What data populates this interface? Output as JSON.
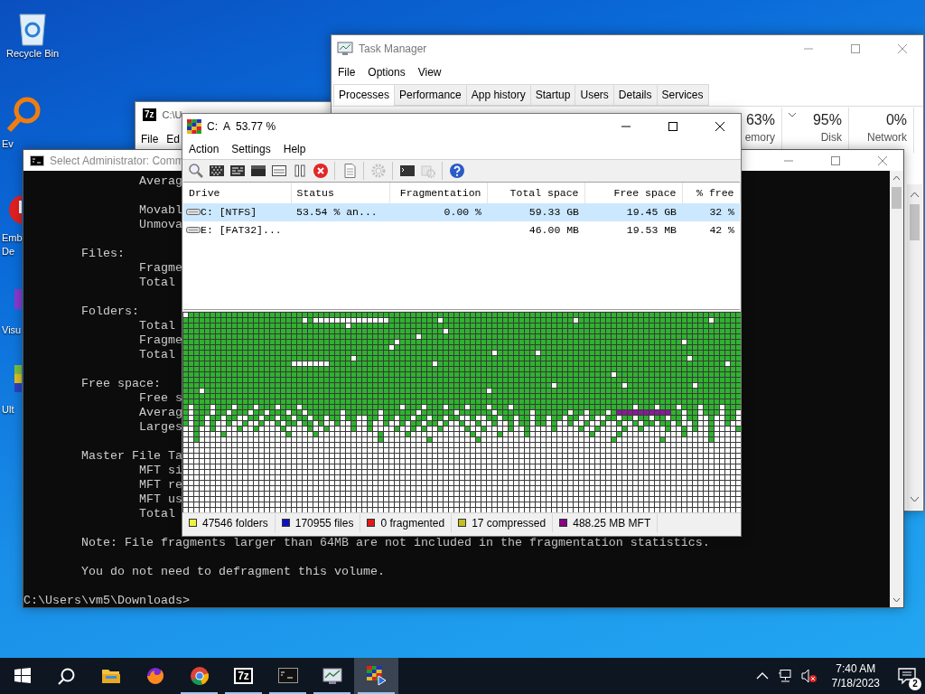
{
  "desktop_icons": [
    {
      "kind": "recycle",
      "lines": [
        "Recycle Bin"
      ]
    },
    {
      "kind": "magnifier",
      "lines": [
        "Ev"
      ]
    },
    {
      "kind": "redball",
      "lines": [
        "Emb",
        "De"
      ]
    },
    {
      "kind": "purple",
      "lines": [
        "Visu"
      ]
    },
    {
      "kind": "bars",
      "lines": [
        "Ult"
      ]
    }
  ],
  "seven_zip_window": {
    "logo": "7z",
    "title": "C:\\U",
    "menu": [
      "File",
      "Ed"
    ]
  },
  "task_manager": {
    "title": "Task Manager",
    "menu": [
      "File",
      "Options",
      "View"
    ],
    "tabs": [
      {
        "label": "Processes",
        "selected": true
      },
      {
        "label": "Performance",
        "selected": false
      },
      {
        "label": "App history",
        "selected": false
      },
      {
        "label": "Startup",
        "selected": false
      },
      {
        "label": "Users",
        "selected": false
      },
      {
        "label": "Details",
        "selected": false
      },
      {
        "label": "Services",
        "selected": false
      }
    ],
    "columns": [
      {
        "value": "63%",
        "label": "emory",
        "sorted": false
      },
      {
        "value": "95%",
        "label": "Disk",
        "sorted": true
      },
      {
        "value": "0%",
        "label": "Network",
        "sorted": false
      }
    ]
  },
  "cmd_window": {
    "title": "Select Administrator: Comm",
    "blocks": [
      [
        {
          "kind": "detail",
          "text": "Averag"
        }
      ],
      [
        {
          "kind": "detail",
          "text": "Movabl"
        },
        {
          "kind": "detail",
          "text": "Unmova"
        }
      ],
      [
        {
          "kind": "section",
          "text": "Files:"
        },
        {
          "kind": "detail",
          "text": "Fragme"
        },
        {
          "kind": "detail",
          "text": "Total"
        }
      ],
      [
        {
          "kind": "section",
          "text": "Folders:"
        },
        {
          "kind": "detail",
          "text": "Total"
        },
        {
          "kind": "detail",
          "text": "Fragme"
        },
        {
          "kind": "detail",
          "text": "Total"
        }
      ],
      [
        {
          "kind": "section",
          "text": "Free space:"
        },
        {
          "kind": "detail",
          "text": "Free s"
        },
        {
          "kind": "detail",
          "text": "Averag"
        },
        {
          "kind": "detail",
          "text": "Larges"
        }
      ],
      [
        {
          "kind": "section",
          "text": "Master File Ta"
        },
        {
          "kind": "detail",
          "text": "MFT si"
        },
        {
          "kind": "detail",
          "text": "MFT re"
        },
        {
          "kind": "detail",
          "text": "MFT us"
        },
        {
          "kind": "detail",
          "text": "Total"
        }
      ],
      [
        {
          "kind": "section",
          "text": "Note: File fragments larger than 64MB are not included in the fragmentation statistics."
        }
      ],
      [
        {
          "kind": "section",
          "text": "You do not need to defragment this volume."
        }
      ],
      [
        {
          "kind": "prompt",
          "text": "C:\\Users\\vm5\\Downloads>"
        }
      ]
    ]
  },
  "defrag_window": {
    "title": "C:  A  53.77 %",
    "menu": [
      "Action",
      "Settings",
      "Help"
    ],
    "toolbar": [
      {
        "kind": "magnifier",
        "disabled": false
      },
      {
        "kind": "checker",
        "disabled": false
      },
      {
        "kind": "bars",
        "disabled": false
      },
      {
        "kind": "block",
        "disabled": false
      },
      {
        "kind": "panel",
        "disabled": false
      },
      {
        "kind": "pause",
        "disabled": false
      },
      {
        "kind": "stop",
        "disabled": false
      },
      {
        "kind": "separator"
      },
      {
        "kind": "document",
        "disabled": false
      },
      {
        "kind": "separator"
      },
      {
        "kind": "gear",
        "disabled": true
      },
      {
        "kind": "separator"
      },
      {
        "kind": "console",
        "disabled": false
      },
      {
        "kind": "cog",
        "disabled": true
      },
      {
        "kind": "separator"
      },
      {
        "kind": "help",
        "disabled": false
      }
    ],
    "columns": [
      {
        "label": "Drive",
        "kind": "text"
      },
      {
        "label": "Status",
        "kind": "text"
      },
      {
        "label": "Fragmentation",
        "kind": "number"
      },
      {
        "label": "Total space",
        "kind": "number"
      },
      {
        "label": "Free space",
        "kind": "number"
      },
      {
        "label": "% free",
        "kind": "number"
      }
    ],
    "rows": [
      {
        "selected": true,
        "cells": [
          "C: [NTFS]",
          "53.54 % an...",
          "0.00 %",
          "59.33 GB",
          "19.45 GB",
          "32 %"
        ]
      },
      {
        "selected": false,
        "cells": [
          "E: [FAT32]...",
          null,
          null,
          "46.00 MB",
          "19.53 MB",
          "42 %"
        ]
      }
    ],
    "legend": [
      {
        "text": "47546 folders",
        "color": "#f0f040"
      },
      {
        "text": "170955 files",
        "color": "#1010c8"
      },
      {
        "text": "0 fragmented",
        "color": "#e01818"
      },
      {
        "text": "17 compressed",
        "color": "#c0c020"
      },
      {
        "text": "488.25 MB MFT",
        "color": "#880088"
      }
    ]
  },
  "taskbar": {
    "items": [
      {
        "kind": "start"
      },
      {
        "kind": "search"
      },
      {
        "kind": "folder",
        "running": false,
        "selected": false
      },
      {
        "kind": "firefox",
        "running": false,
        "selected": false
      },
      {
        "kind": "chrome",
        "running": true,
        "selected": false
      },
      {
        "kind": "archive",
        "logo": "7z",
        "running": true,
        "selected": false
      },
      {
        "kind": "console",
        "running": true,
        "selected": false
      },
      {
        "kind": "monitor",
        "running": true,
        "selected": false
      },
      {
        "kind": "defrag",
        "running": true,
        "selected": true
      }
    ],
    "time": "7:40 AM",
    "date": "7/18/2023",
    "notifications": "2"
  }
}
